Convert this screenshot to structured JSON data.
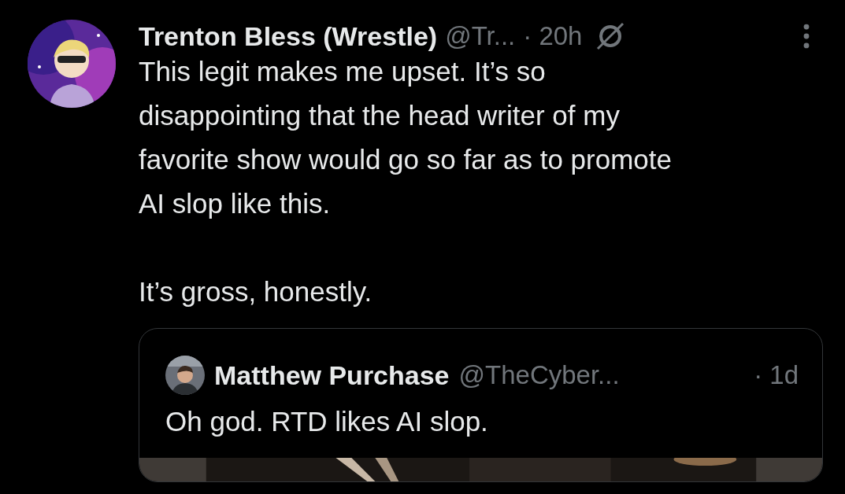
{
  "post": {
    "author": "Trenton Bless (Wrestle)",
    "handle": "@Tr...",
    "time": "· 20h",
    "text": "This legit makes me upset. It’s so\ndisappointing that the head writer of my\nfavorite show would go so far as to promote\nAI slop like this.\n\nIt’s gross, honestly.",
    "quote": {
      "author": "Matthew Purchase",
      "handle": "@TheCyber...",
      "time": "· 1d",
      "text": "Oh god. RTD likes AI slop."
    }
  }
}
